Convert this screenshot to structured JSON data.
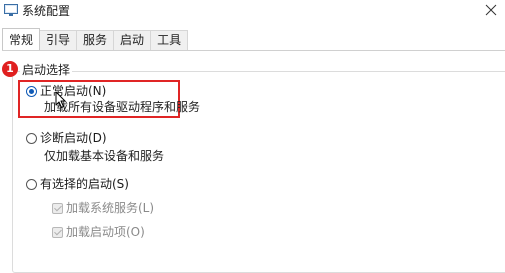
{
  "window": {
    "title": "系统配置"
  },
  "tabs": [
    {
      "label": "常规",
      "active": true
    },
    {
      "label": "引导"
    },
    {
      "label": "服务"
    },
    {
      "label": "启动"
    },
    {
      "label": "工具"
    }
  ],
  "startup_group": {
    "label": "启动选择",
    "step_badge": "1"
  },
  "options": {
    "normal": {
      "label": "正常启动(N)",
      "description": "加载所有设备驱动程序和服务",
      "selected": true
    },
    "diagnostic": {
      "label": "诊断启动(D)",
      "description": "仅加载基本设备和服务",
      "selected": false
    },
    "selective": {
      "label": "有选择的启动(S)",
      "selected": false
    }
  },
  "selective_checks": {
    "load_system_services": {
      "label": "加载系统服务(L)",
      "checked": true,
      "disabled": true
    },
    "load_startup_items": {
      "label": "加载启动项(O)",
      "checked": true,
      "disabled": true
    }
  },
  "colors": {
    "highlight": "#e02525",
    "badge": "#e02020",
    "radio_accent": "#0f5ab6"
  }
}
